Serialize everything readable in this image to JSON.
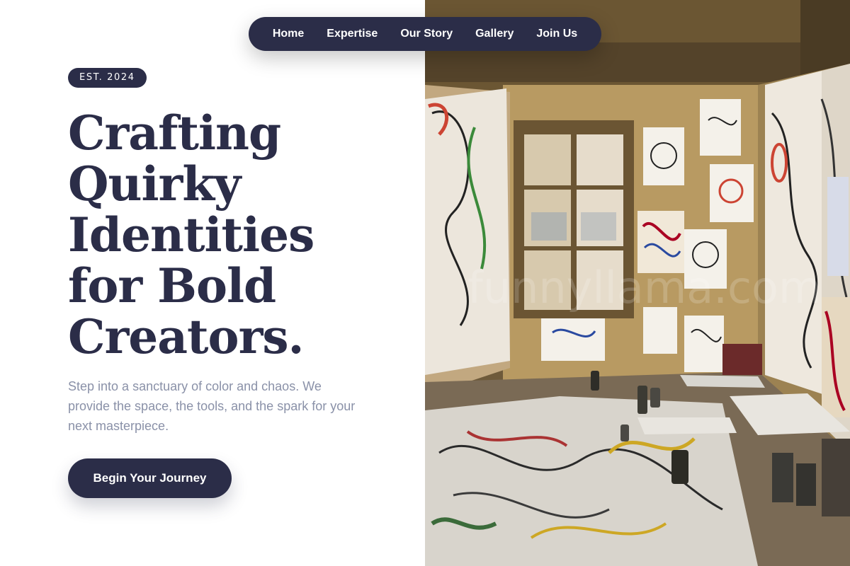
{
  "nav": {
    "links": [
      "Home",
      "Expertise",
      "Our Story",
      "Gallery",
      "Join Us"
    ]
  },
  "hero": {
    "badge": "EST. 2024",
    "headline": [
      "Crafting",
      "Quirky",
      "Identities",
      "for Bold",
      "Creators."
    ],
    "subtext": "Step into a sanctuary of color and chaos. We provide the space, the tools, and the spark for your next masterpiece.",
    "cta_label": "Begin Your Journey"
  },
  "image": {
    "watermark": "funnyllama.com"
  },
  "colors": {
    "primary": "#2b2d48",
    "muted_text": "#8a91a8",
    "background": "#ffffff"
  }
}
